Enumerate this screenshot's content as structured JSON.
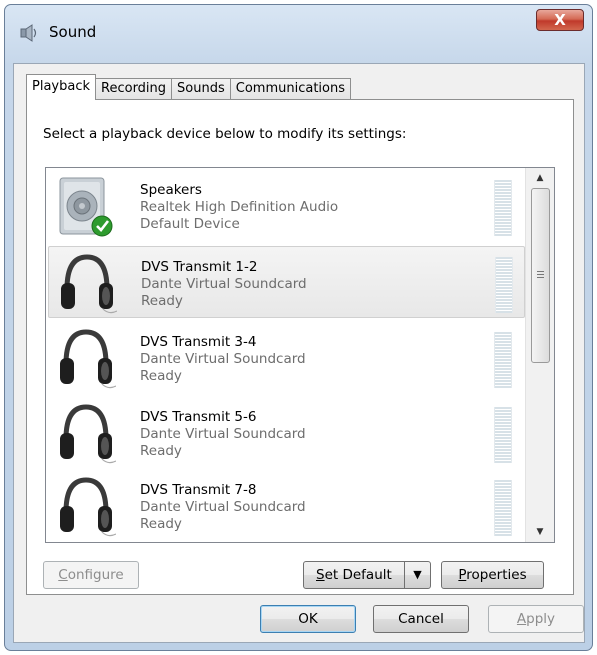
{
  "window": {
    "title": "Sound",
    "close_label": "X"
  },
  "tabs": [
    {
      "label": "Playback",
      "active": true
    },
    {
      "label": "Recording",
      "active": false
    },
    {
      "label": "Sounds",
      "active": false
    },
    {
      "label": "Communications",
      "active": false
    }
  ],
  "instructions": "Select a playback device below to modify its settings:",
  "devices": [
    {
      "name": "Speakers",
      "driver": "Realtek High Definition Audio",
      "status": "Default Device",
      "icon": "speaker-icon",
      "default": true,
      "selected": false
    },
    {
      "name": "DVS Transmit  1-2",
      "driver": "Dante Virtual Soundcard",
      "status": "Ready",
      "icon": "headphones-icon",
      "default": false,
      "selected": true
    },
    {
      "name": "DVS Transmit  3-4",
      "driver": "Dante Virtual Soundcard",
      "status": "Ready",
      "icon": "headphones-icon",
      "default": false,
      "selected": false
    },
    {
      "name": "DVS Transmit  5-6",
      "driver": "Dante Virtual Soundcard",
      "status": "Ready",
      "icon": "headphones-icon",
      "default": false,
      "selected": false
    },
    {
      "name": "DVS Transmit  7-8",
      "driver": "Dante Virtual Soundcard",
      "status": "Ready",
      "icon": "headphones-icon",
      "default": false,
      "selected": false
    }
  ],
  "buttons": {
    "configure": {
      "label_first": "C",
      "label_rest": "onfigure",
      "enabled": false
    },
    "set_default": {
      "label_first": "S",
      "label_rest": "et Default",
      "split_arrow": "▼"
    },
    "properties": {
      "label_first": "P",
      "label_rest": "roperties"
    },
    "ok": {
      "label": "OK"
    },
    "cancel": {
      "label": "Cancel"
    },
    "apply": {
      "label_first": "A",
      "label_rest": "pply",
      "enabled": false
    }
  },
  "scrollbar": {
    "up_arrow": "▲",
    "down_arrow": "▼"
  },
  "colors": {
    "close_button": "#c0392b",
    "default_check": "#2e9b2e",
    "selection": "#e8e8e8"
  }
}
